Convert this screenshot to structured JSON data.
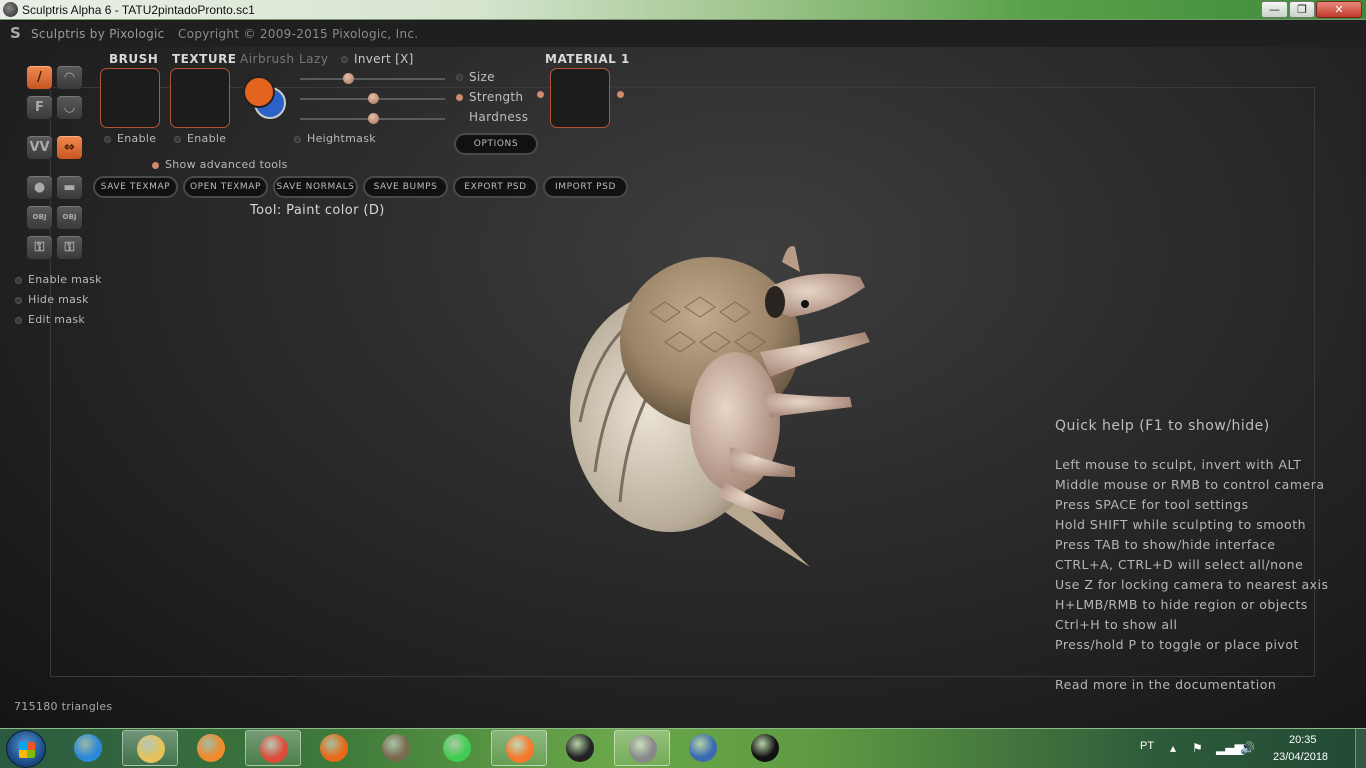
{
  "window": {
    "title": "Sculptris Alpha 6 - TATU2pintadoPronto.sc1",
    "minimize": "—",
    "maximize": "❐",
    "close": "✕"
  },
  "header": {
    "brand": "Sculptris by Pixologic",
    "copyright": "Copyright © 2009-2015 Pixologic, Inc."
  },
  "tools": {
    "column": [
      {
        "name": "draw-tool",
        "glyph": "/",
        "active": true
      },
      {
        "name": "flatten-tool",
        "glyph": "◠"
      },
      {
        "name": "f-tool",
        "glyph": "F"
      },
      {
        "name": "crease-tool",
        "glyph": "◡"
      },
      {
        "name": "pinch-tool",
        "glyph": "VV"
      },
      {
        "name": "grab-tool",
        "glyph": "⇔",
        "active": true
      },
      {
        "name": "sphere-tool",
        "glyph": "●"
      },
      {
        "name": "plane-tool",
        "glyph": "▬"
      },
      {
        "name": "obj-import",
        "glyph": "OBJ"
      },
      {
        "name": "obj-export",
        "glyph": "OBJ"
      },
      {
        "name": "lock-tool",
        "glyph": "⚿"
      },
      {
        "name": "lock-tool-2",
        "glyph": "⚿"
      }
    ],
    "mask": {
      "enable": "Enable mask",
      "hide": "Hide mask",
      "edit": "Edit mask"
    }
  },
  "brush": {
    "brush_label": "BRUSH",
    "texture_label": "TEXTURE",
    "airbrush_label": "Airbrush",
    "lazy_label": "Lazy",
    "invert_label": "Invert [X]",
    "brush_enable": "Enable",
    "texture_enable": "Enable",
    "heightmask": "Heightmask",
    "advanced": "Show advanced tools",
    "size_label": "Size",
    "strength_label": "Strength",
    "hardness_label": "Hardness",
    "options": "OPTIONS",
    "material_label": "MATERIAL 1",
    "size_value": 0.33,
    "strength_value": 0.5,
    "hardness_value": 0.5,
    "color_fg": "#e5641f",
    "color_bg": "#2a62c9"
  },
  "actions": [
    "SAVE TEXMAP",
    "OPEN TEXMAP",
    "SAVE NORMALS",
    "SAVE BUMPS",
    "EXPORT PSD",
    "IMPORT PSD"
  ],
  "status": {
    "tool": "Tool: Paint color (D)",
    "triangles": "715180 triangles"
  },
  "quick_help": {
    "title": "Quick help (F1 to show/hide)",
    "lines": [
      "Left mouse to sculpt, invert with ALT",
      "Middle mouse or RMB to control camera",
      "Press SPACE for tool settings",
      "Hold SHIFT while sculpting to smooth",
      "Press TAB to show/hide interface",
      "CTRL+A, CTRL+D will select all/none",
      "Use Z for locking camera to nearest axis",
      "H+LMB/RMB to hide region or objects",
      "Ctrl+H to show all",
      "Press/hold P to toggle or place pivot"
    ],
    "more": "Read more in the documentation"
  },
  "taskbar": {
    "items": [
      {
        "name": "internet-explorer-icon",
        "color": "#2a8ad8"
      },
      {
        "name": "file-explorer-icon",
        "color": "#e6c25a"
      },
      {
        "name": "media-player-icon",
        "color": "#f08a2a"
      },
      {
        "name": "chrome-icon",
        "color": "#dd4b39"
      },
      {
        "name": "firefox-icon",
        "color": "#e66a1a"
      },
      {
        "name": "gimp-icon",
        "color": "#7a6a50"
      },
      {
        "name": "qt-icon",
        "color": "#41cd52"
      },
      {
        "name": "blender-icon",
        "color": "#f5792a"
      },
      {
        "name": "unity-icon",
        "color": "#222222"
      },
      {
        "name": "sculptris-icon",
        "color": "#888888"
      },
      {
        "name": "app-icon-blue",
        "color": "#3a6ab0"
      },
      {
        "name": "inkscape-icon",
        "color": "#111111"
      }
    ],
    "lang": "PT",
    "time": "20:35",
    "date": "23/04/2018"
  }
}
